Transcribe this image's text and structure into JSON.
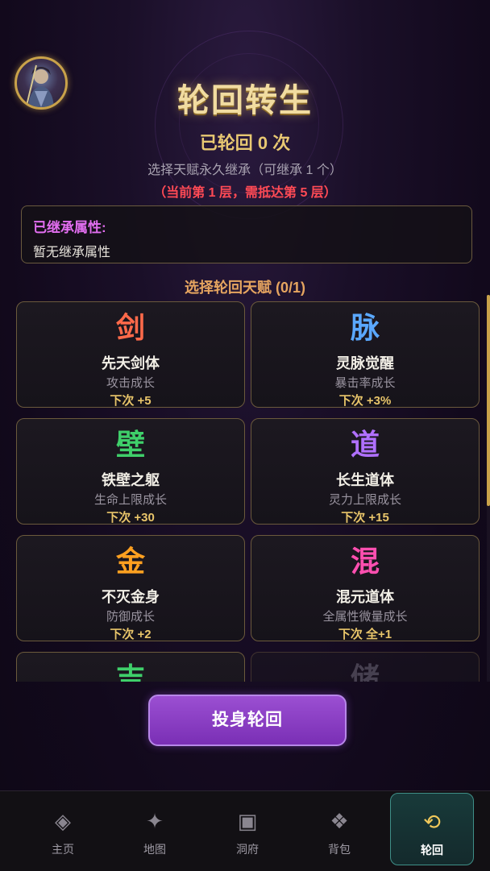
{
  "header": {
    "title": "轮回转生",
    "count_text": "已轮回 0 次",
    "subtitle": "选择天赋永久继承（可继承 1 个）",
    "warning": "（当前第 1 层，需抵达第 5 层）"
  },
  "inherit": {
    "title": "已继承属性:",
    "value": "暂无继承属性"
  },
  "section_label": "选择轮回天赋 (0/1)",
  "talents": [
    {
      "glyph": "剑",
      "name": "先天剑体",
      "desc": "攻击成长",
      "bonus": "下次 +5",
      "color": "#ff6a4a"
    },
    {
      "glyph": "脉",
      "name": "灵脉觉醒",
      "desc": "暴击率成长",
      "bonus": "下次 +3%",
      "color": "#5aa8ff"
    },
    {
      "glyph": "壁",
      "name": "铁壁之躯",
      "desc": "生命上限成长",
      "bonus": "下次 +30",
      "color": "#3fcf6a"
    },
    {
      "glyph": "道",
      "name": "长生道体",
      "desc": "灵力上限成长",
      "bonus": "下次 +15",
      "color": "#b070ff"
    },
    {
      "glyph": "金",
      "name": "不灭金身",
      "desc": "防御成长",
      "bonus": "下次 +2",
      "color": "#ffa020"
    },
    {
      "glyph": "混",
      "name": "混元道体",
      "desc": "全属性微量成长",
      "bonus": "下次 全+1",
      "color": "#ff4fb0"
    },
    {
      "glyph": "吉",
      "color": "#3fcf6a"
    },
    {
      "glyph": "储",
      "color": "#7a7682"
    }
  ],
  "action": {
    "reborn_label": "投身轮回"
  },
  "nav": [
    {
      "label": "主页",
      "icon": "diamond-icon"
    },
    {
      "label": "地图",
      "icon": "sparkle-icon"
    },
    {
      "label": "洞府",
      "icon": "square-icon"
    },
    {
      "label": "背包",
      "icon": "dots-icon"
    },
    {
      "label": "轮回",
      "icon": "cycle-icon",
      "active": true
    }
  ],
  "colors": {
    "gold": "#c9a24a",
    "purple_button": "#8a3fc5",
    "warning": "#ff4a55",
    "active_tab": "#183a3a"
  }
}
